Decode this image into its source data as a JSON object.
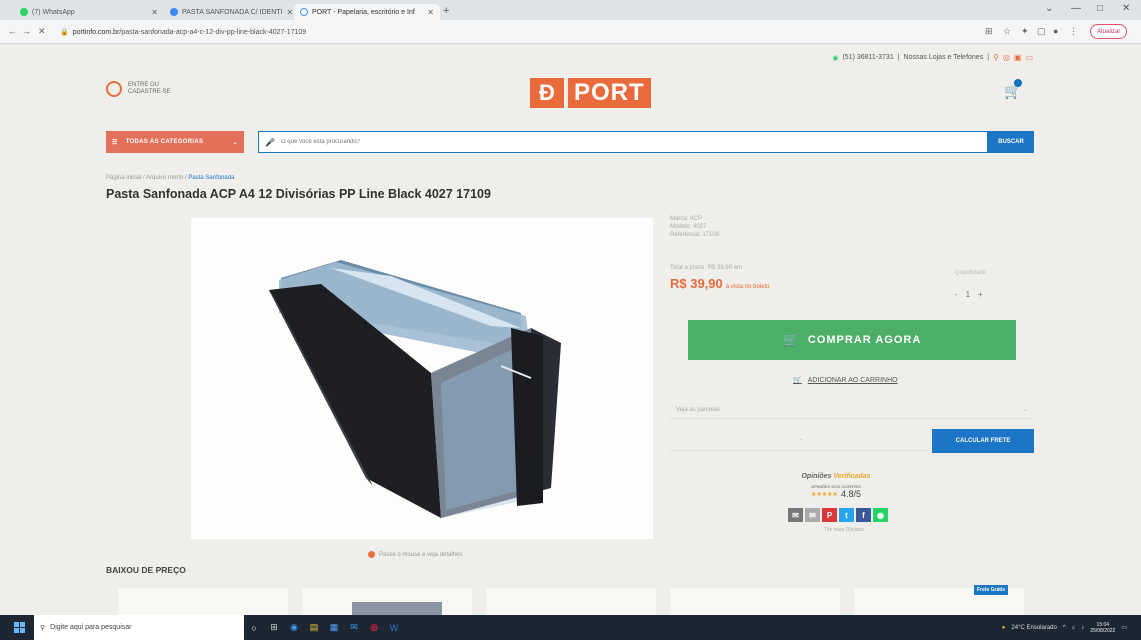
{
  "browser": {
    "tabs": [
      {
        "label": "(7) WhatsApp",
        "active": false
      },
      {
        "label": "PASTA SANFONADA C/ IDENTI",
        "active": false
      },
      {
        "label": "PORT - Papelaria, escritório e Inf",
        "active": true
      }
    ],
    "url_host": "portinfo.com.br",
    "url_path": "/pasta-sanfonada-acp-a4-c-12-div-pp-line-black-4027-17109",
    "update_label": "Atualizar"
  },
  "header": {
    "contact_phone": "(51) 36811-3731",
    "stores_link": "Nossas Lojas e Telefones",
    "login_text": "ENTRE OU CADASTRE-SE",
    "logo_text": "PORT",
    "categories_label": "TODAS AS CATEGORIAS",
    "search_placeholder": "O que você está procurando?",
    "search_button": "BUSCAR"
  },
  "product": {
    "breadcrumb_path": "Página inicial / Arquivo morto /",
    "breadcrumb_current": "Pasta Sanfonada",
    "title": "Pasta Sanfonada ACP A4 12 Divisórias PP Line Black 4027 17109",
    "brand": "Marca: ACP",
    "model": "Modelo: 4027",
    "reference": "Referência: 17109",
    "price_from": "Total a prazo: R$ 39,90 em",
    "price": "R$ 39,90",
    "price_note": "à vista no boleto",
    "quantity_label": "Quantidade",
    "quantity": "1",
    "buy_button": "COMPRAR AGORA",
    "add_to_cart": "ADICIONAR AO CARRINHO",
    "installments_placeholder": "Veja as parcelas",
    "cep_placeholder": "-",
    "shipping_button": "CALCULAR FRETE",
    "zoom_hint": "Passe o mouse e veja detalhes"
  },
  "reviews": {
    "brand_a": "Opiniões",
    "brand_b": "Verificadas",
    "label": "OPINIÕES DOS CLIENTES",
    "score": "4.8/5",
    "stars": "★★★★★",
    "share_label": "Tire suas Dúvidas"
  },
  "section": {
    "title": "BAIXOU DE PREÇO",
    "badge": "Frete Grátis"
  },
  "taskbar": {
    "search_text": "Digite aqui para pesquisar",
    "weather": "24°C Ensolarado",
    "time": "15:04",
    "date": "25/08/2022"
  },
  "colors": {
    "accent": "#e96b3b",
    "blue": "#1c75c6",
    "green": "#4caf68"
  }
}
